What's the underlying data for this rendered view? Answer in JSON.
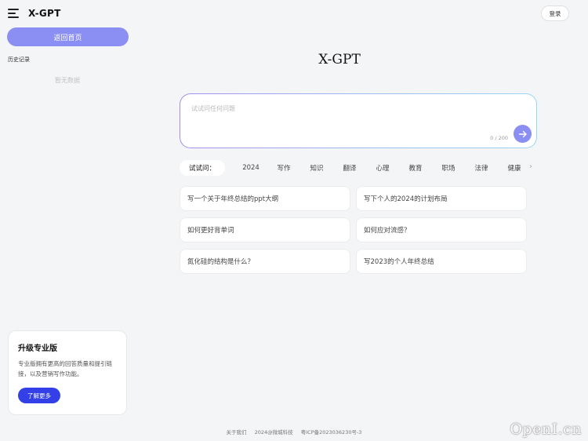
{
  "app": {
    "brand": "X-GPT",
    "title": "X-GPT"
  },
  "sidebar": {
    "home_label": "返回首页",
    "history_title": "历史记录",
    "history_empty": "暂无数据",
    "pro": {
      "title": "升级专业版",
      "desc": "专业版拥有更高的回答质量和提引链接，以及营销写作功能。",
      "button": "了解更多"
    }
  },
  "header": {
    "login_label": "登录"
  },
  "input": {
    "placeholder": "试试问任何问题",
    "value": "",
    "counter": "0 / 200"
  },
  "tabs": [
    "试试问：",
    "2024",
    "写作",
    "知识",
    "翻译",
    "心理",
    "教育",
    "职场",
    "法律",
    "健康"
  ],
  "suggestions": [
    "写一个关于年终总结的ppt大纲",
    "写下个人的2024的计划布局",
    "如何更好背单词",
    "如何应对流感？",
    "氮化硅的结构是什么？",
    "写2023的个人年终总结"
  ],
  "footer": {
    "about": "关于我们",
    "copyright": "2024@微城科技",
    "icp": "粤ICP备2023036230号-3"
  },
  "watermark": "OpenI.cn",
  "colors": {
    "accent": "#8b8ef2",
    "pro_button": "#3340e8"
  }
}
